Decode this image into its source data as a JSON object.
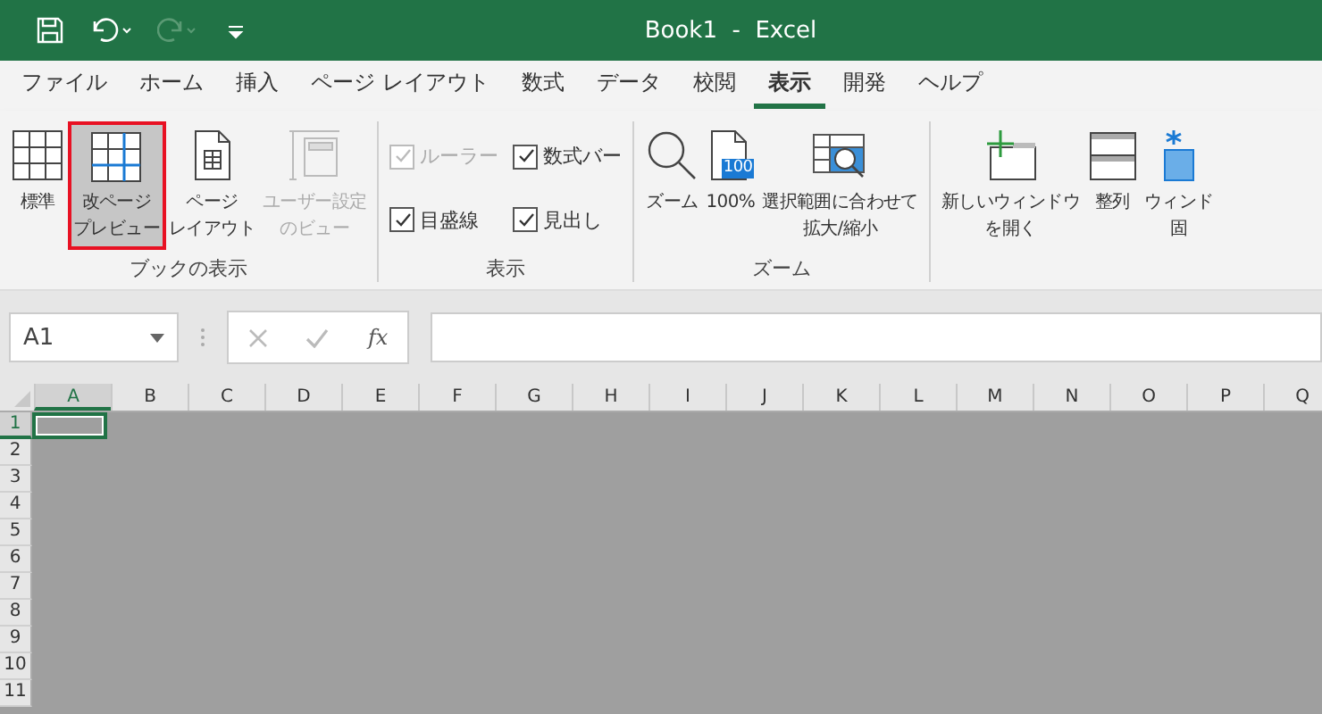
{
  "window": {
    "title": "Book1  -  Excel"
  },
  "tabs": [
    {
      "label": "ファイル",
      "selected": false
    },
    {
      "label": "ホーム",
      "selected": false
    },
    {
      "label": "挿入",
      "selected": false
    },
    {
      "label": "ページ レイアウト",
      "selected": false
    },
    {
      "label": "数式",
      "selected": false
    },
    {
      "label": "データ",
      "selected": false
    },
    {
      "label": "校閲",
      "selected": false
    },
    {
      "label": "表示",
      "selected": true
    },
    {
      "label": "開発",
      "selected": false
    },
    {
      "label": "ヘルプ",
      "selected": false
    }
  ],
  "ribbon_groups": [
    {
      "label": "ブックの表示",
      "items": [
        {
          "kind": "button",
          "lines": [
            "標準"
          ],
          "selected": false,
          "disabled": false
        },
        {
          "kind": "button",
          "lines": [
            "改ページ",
            "プレビュー"
          ],
          "selected": true,
          "disabled": false
        },
        {
          "kind": "button",
          "lines": [
            "ページ",
            "レイアウト"
          ],
          "selected": false,
          "disabled": false
        },
        {
          "kind": "button",
          "lines": [
            "ユーザー設定",
            "のビュー"
          ],
          "selected": false,
          "disabled": true
        }
      ]
    },
    {
      "label": "表示",
      "items": [
        {
          "kind": "checks",
          "checks": [
            {
              "label": "ルーラー",
              "checked": true,
              "disabled": true
            },
            {
              "label": "目盛線",
              "checked": true,
              "disabled": false
            },
            {
              "label": "数式バー",
              "checked": true,
              "disabled": false
            },
            {
              "label": "見出し",
              "checked": true,
              "disabled": false
            }
          ]
        }
      ]
    },
    {
      "label": "ズーム",
      "items": [
        {
          "kind": "button",
          "lines": [
            "ズーム"
          ],
          "selected": false,
          "disabled": false
        },
        {
          "kind": "button",
          "badge": "100",
          "lines": [
            "100%"
          ],
          "selected": false,
          "disabled": false
        },
        {
          "kind": "button",
          "lines": [
            "選択範囲に合わせて",
            "拡大/縮小"
          ],
          "selected": false,
          "disabled": false
        }
      ]
    },
    {
      "items": [
        {
          "kind": "button",
          "lines": [
            "新しいウィンドウ",
            "を開く"
          ],
          "selected": false,
          "disabled": false
        },
        {
          "kind": "button",
          "lines": [
            "整列"
          ],
          "selected": false,
          "disabled": false
        },
        {
          "kind": "button",
          "lines": [
            "ウィンド",
            "固"
          ],
          "selected": false,
          "disabled": false
        }
      ]
    }
  ],
  "name_box": {
    "value": "A1"
  },
  "formula_bar": {
    "fx": "fx"
  },
  "sheet": {
    "columns": [
      {
        "label": "A",
        "selected": true
      },
      {
        "label": "B",
        "selected": false
      },
      {
        "label": "C",
        "selected": false
      },
      {
        "label": "D",
        "selected": false
      },
      {
        "label": "E",
        "selected": false
      },
      {
        "label": "F",
        "selected": false
      },
      {
        "label": "G",
        "selected": false
      },
      {
        "label": "H",
        "selected": false
      },
      {
        "label": "I",
        "selected": false
      },
      {
        "label": "J",
        "selected": false
      },
      {
        "label": "K",
        "selected": false
      },
      {
        "label": "L",
        "selected": false
      },
      {
        "label": "M",
        "selected": false
      },
      {
        "label": "N",
        "selected": false
      },
      {
        "label": "O",
        "selected": false
      },
      {
        "label": "P",
        "selected": false
      },
      {
        "label": "Q",
        "selected": false
      }
    ],
    "rows": [
      {
        "label": "1",
        "selected": true
      },
      {
        "label": "2",
        "selected": false
      },
      {
        "label": "3",
        "selected": false
      },
      {
        "label": "4",
        "selected": false
      },
      {
        "label": "5",
        "selected": false
      },
      {
        "label": "6",
        "selected": false
      },
      {
        "label": "7",
        "selected": false
      },
      {
        "label": "8",
        "selected": false
      },
      {
        "label": "9",
        "selected": false
      },
      {
        "label": "10",
        "selected": false
      },
      {
        "label": "11",
        "selected": false
      }
    ]
  }
}
